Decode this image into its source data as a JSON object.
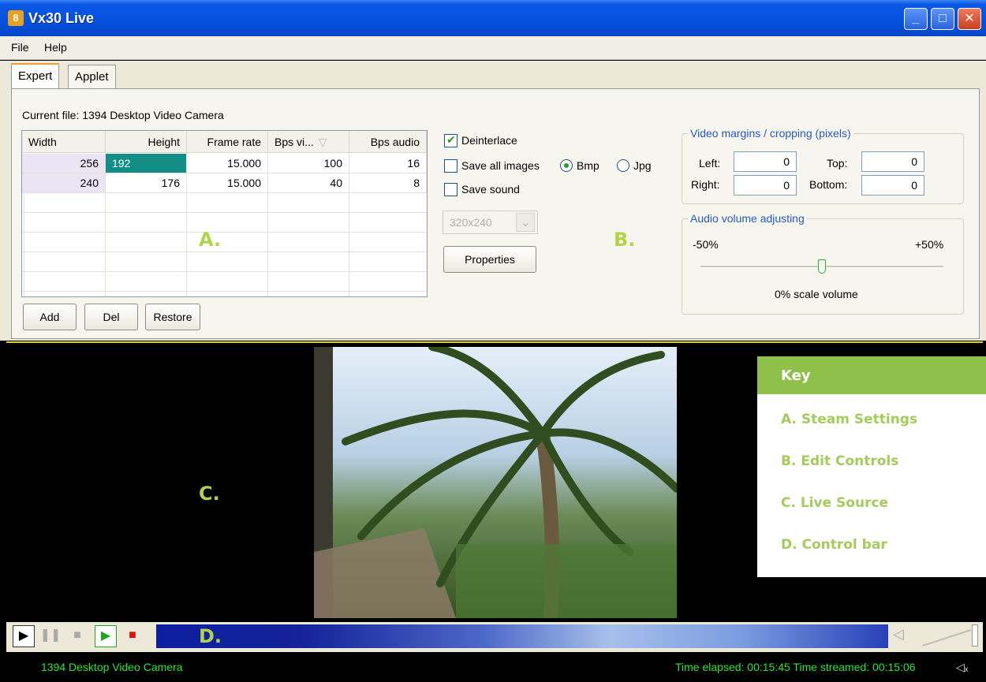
{
  "window": {
    "title": "Vx30 Live",
    "icon": "app-icon",
    "minimize": "_",
    "maximize": "□",
    "close": "✕"
  },
  "menu": [
    "File",
    "Help"
  ],
  "tabs": [
    "Expert",
    "Applet"
  ],
  "current_file": "Current file: 1394 Desktop Video Camera",
  "table": {
    "headers": [
      "Width",
      "Height",
      "Frame rate",
      "Bps vi...",
      "Bps audio"
    ],
    "rows": [
      [
        "256",
        "192",
        "15.000",
        "100",
        "16"
      ],
      [
        "240",
        "176",
        "15.000",
        "40",
        "8"
      ]
    ]
  },
  "table_buttons": [
    "Add",
    "Del",
    "Restore"
  ],
  "labels": {
    "a": "A.",
    "b": "B.",
    "c": "C.",
    "d": "D."
  },
  "edit": {
    "deinterlace": "Deinterlace",
    "save_all_images": "Save all images",
    "bmp": "Bmp",
    "jpg": "Jpg",
    "save_sound": "Save sound",
    "resolution": "320x240",
    "properties": "Properties"
  },
  "margins": {
    "title": "Video margins / cropping (pixels)",
    "left_label": "Left:",
    "left": "0",
    "top_label": "Top:",
    "top": "0",
    "right_label": "Right:",
    "right": "0",
    "bottom_label": "Bottom:",
    "bottom": "0"
  },
  "audio": {
    "title": "Audio volume adjusting",
    "min": "-50%",
    "max": "+50%",
    "value_text": "0% scale volume",
    "level": 0.5
  },
  "key": {
    "title": "Key",
    "items": [
      "A. Steam Settings",
      "B. Edit Controls",
      "C. Live Source",
      "D. Control bar"
    ]
  },
  "status": {
    "source": "1394 Desktop Video Camera",
    "time": "Time elapsed: 00:15:45 Time streamed: 00:15:06"
  },
  "colors": {
    "accent_green": "#8fc04a",
    "status_green": "#27e630",
    "title_blue": "#0650dc"
  }
}
